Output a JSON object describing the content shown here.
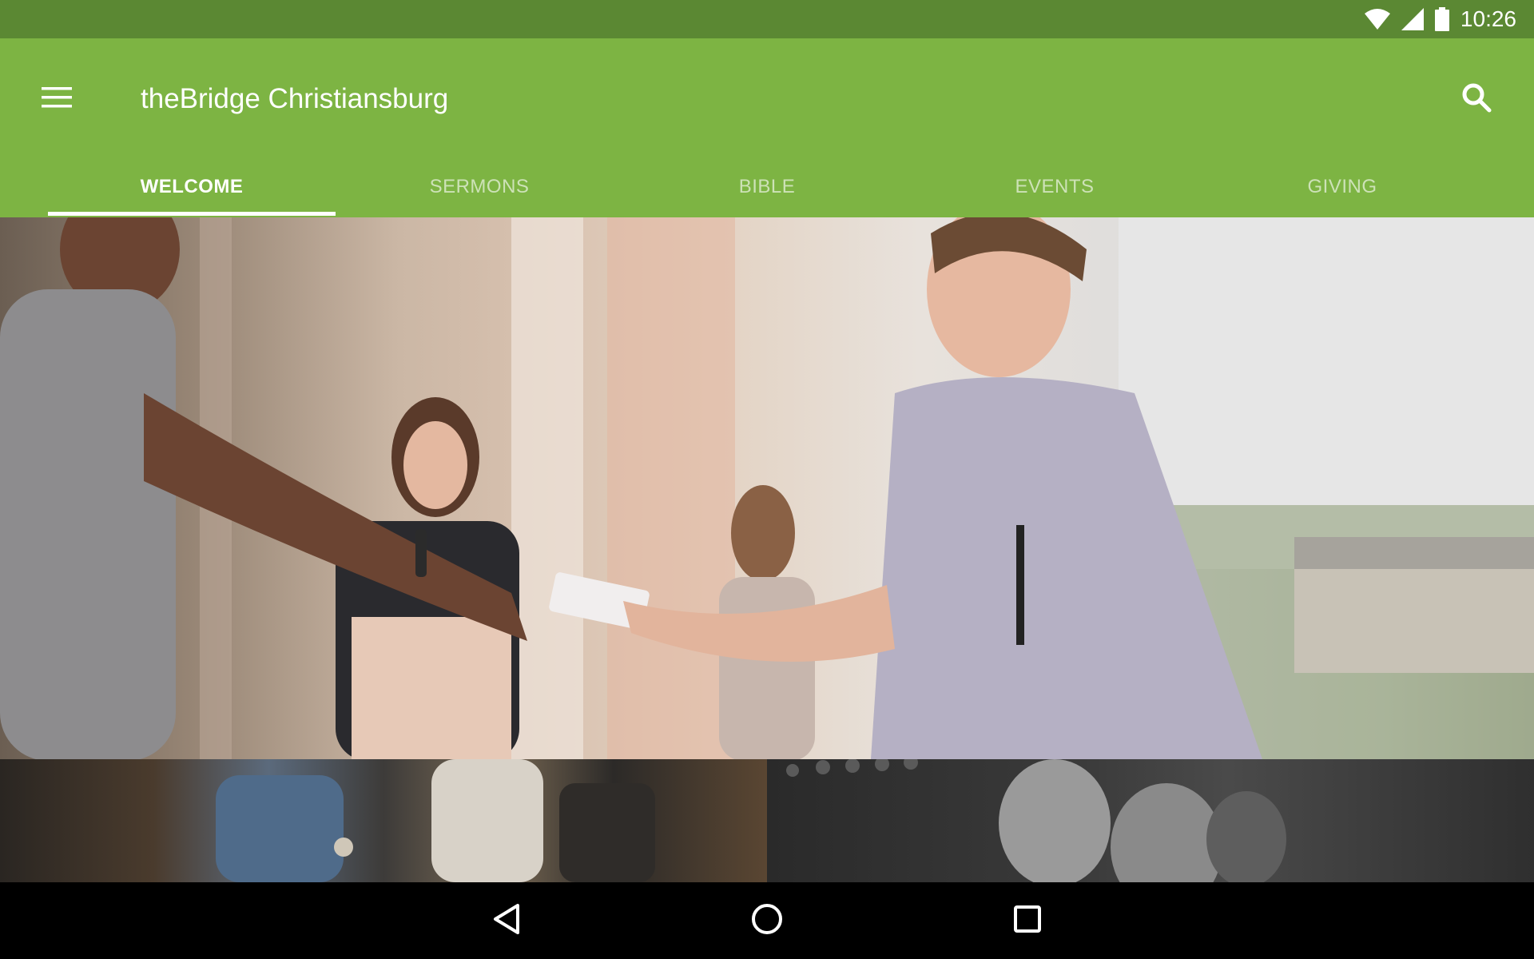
{
  "status_bar": {
    "time": "10:26",
    "icons": [
      "wifi-icon",
      "cellular-signal-icon",
      "battery-icon"
    ]
  },
  "app_bar": {
    "title": "theBridge Christiansburg",
    "menu_icon": "hamburger-menu-icon",
    "search_icon": "search-icon",
    "color": "#7db443",
    "status_color": "#5b8833"
  },
  "tabs": [
    {
      "label": "WELCOME",
      "active": true
    },
    {
      "label": "SERMONS",
      "active": false
    },
    {
      "label": "BIBLE",
      "active": false
    },
    {
      "label": "EVENTS",
      "active": false
    },
    {
      "label": "GIVING",
      "active": false
    }
  ],
  "content": {
    "hero_image": "welcome-photo-greeting",
    "tiles": [
      "congregation-seated-photo",
      "prayer-photo-bw"
    ]
  },
  "nav_bar": {
    "buttons": [
      "back-icon",
      "home-icon",
      "recents-icon"
    ]
  }
}
